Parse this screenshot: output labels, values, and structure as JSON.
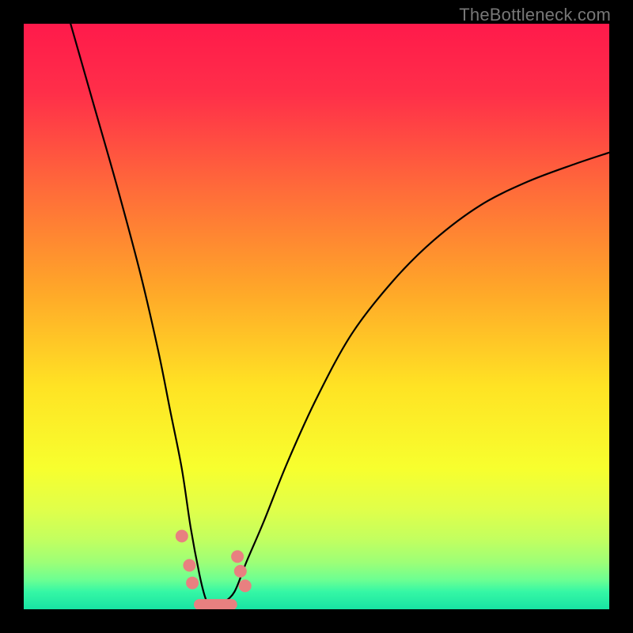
{
  "watermark": "TheBottleneck.com",
  "chart_data": {
    "type": "line",
    "title": "",
    "xlabel": "",
    "ylabel": "",
    "xlim": [
      0,
      100
    ],
    "ylim": [
      0,
      100
    ],
    "series": [
      {
        "name": "bottleneck-curve",
        "x": [
          8,
          12,
          16,
          20,
          23,
          25,
          27,
          28.5,
          30,
          31,
          32,
          33,
          34,
          36,
          38,
          41,
          45,
          50,
          56,
          63,
          70,
          78,
          86,
          94,
          100
        ],
        "y": [
          100,
          86,
          72,
          57,
          44,
          34,
          24,
          14,
          6,
          2,
          0,
          0,
          1,
          3,
          8,
          15,
          25,
          36,
          47,
          56,
          63,
          69,
          73,
          76,
          78
        ]
      }
    ],
    "markers": [
      {
        "x": 27.0,
        "y": 12.5
      },
      {
        "x": 28.3,
        "y": 7.5
      },
      {
        "x": 28.8,
        "y": 4.5
      },
      {
        "x": 36.5,
        "y": 9.0
      },
      {
        "x": 37.0,
        "y": 6.5
      },
      {
        "x": 37.8,
        "y": 4.0
      }
    ],
    "bottom_band": {
      "x_start": 30.0,
      "x_end": 35.5,
      "y": 0.8
    },
    "gradient_stops": [
      {
        "pct": 0,
        "color": "#ff1a4b"
      },
      {
        "pct": 12,
        "color": "#ff2f49"
      },
      {
        "pct": 28,
        "color": "#ff6a3a"
      },
      {
        "pct": 45,
        "color": "#ffa529"
      },
      {
        "pct": 62,
        "color": "#ffe324"
      },
      {
        "pct": 76,
        "color": "#f7ff2e"
      },
      {
        "pct": 83,
        "color": "#e0ff4a"
      },
      {
        "pct": 88,
        "color": "#c3ff5f"
      },
      {
        "pct": 92,
        "color": "#9dff77"
      },
      {
        "pct": 95,
        "color": "#6cff92"
      },
      {
        "pct": 97,
        "color": "#35f7a5"
      },
      {
        "pct": 100,
        "color": "#18e3a3"
      }
    ]
  }
}
